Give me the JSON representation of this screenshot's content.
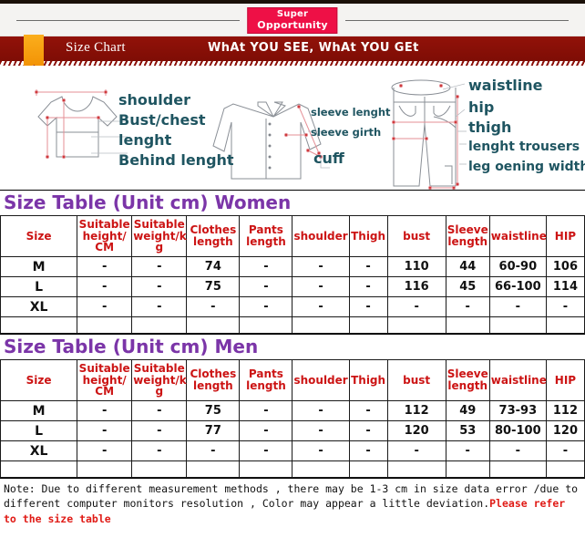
{
  "brand": {
    "line1": "Super",
    "line2": "Opportunity",
    "badge_color": "#ee1046"
  },
  "banner": {
    "title": "Size Chart",
    "slogan": "WhAt YOU SEE, WhAt YOU GEt",
    "bg_color": "#8c1008",
    "tab_color": "#f79f10"
  },
  "illustration": {
    "labels": {
      "shoulder": "shoulder",
      "bust_chest": "Bust/chest",
      "lenght": "lenght",
      "behind_lenght": "Behind lenght",
      "sleeve_lenght": "sleeve lenght",
      "sleeve_girth": "sleeve girth",
      "cuff": "cuff",
      "waistline": "waistline",
      "hip": "hip",
      "thigh": "thigh",
      "lenght_trousers": "lenght trousers",
      "leg_opening_width": "leg oening width"
    },
    "label_color": "#1f5561",
    "garment_line_color": "#8a8f96",
    "measure_line_color": "#e58f96"
  },
  "tables": [
    {
      "title": "Size Table (Unit cm) Women",
      "title_color": "#7b35a8",
      "headers": [
        "Size",
        "Suitable height/ CM",
        "Suitable weight/kg",
        "Clothes length",
        "Pants length",
        "shoulder",
        "Thigh",
        "bust",
        "Sleeve length",
        "waistline",
        "HIP"
      ],
      "rows": [
        [
          "M",
          "-",
          "-",
          "74",
          "-",
          "-",
          "-",
          "110",
          "44",
          "60-90",
          "106"
        ],
        [
          "L",
          "-",
          "-",
          "75",
          "-",
          "-",
          "-",
          "116",
          "45",
          "66-100",
          "114"
        ],
        [
          "XL",
          "-",
          "-",
          "-",
          "-",
          "-",
          "-",
          "-",
          "-",
          "-",
          "-"
        ]
      ]
    },
    {
      "title": "Size Table (Unit cm) Men",
      "title_color": "#7b35a8",
      "headers": [
        "Size",
        "Suitable height/ CM",
        "Suitable weight/kg",
        "Clothes length",
        "Pants length",
        "shoulder",
        "Thigh",
        "bust",
        "Sleeve length",
        "waistline",
        "HIP"
      ],
      "rows": [
        [
          "M",
          "-",
          "-",
          "75",
          "-",
          "-",
          "-",
          "112",
          "49",
          "73-93",
          "112"
        ],
        [
          "L",
          "-",
          "-",
          "77",
          "-",
          "-",
          "-",
          "120",
          "53",
          "80-100",
          "120"
        ],
        [
          "XL",
          "-",
          "-",
          "-",
          "-",
          "-",
          "-",
          "-",
          "-",
          "-",
          "-"
        ]
      ]
    }
  ],
  "header_parts": {
    "suitable": "Suitable",
    "height_cm_l1": "height/",
    "height_cm_l2": "CM",
    "weight_l1": "weight/k",
    "weight_l2": "g",
    "clothes_l1": "Clothes",
    "clothes_l2": "length",
    "pants_l1": "Pants",
    "pants_l2": "length",
    "sleeve_l1": "Sleeve",
    "sleeve_l2": "length",
    "size": "Size",
    "shoulder": "shoulder",
    "thigh": "Thigh",
    "bust": "bust",
    "waistline": "waistline",
    "hip": "HIP"
  },
  "note": {
    "text_black": "Note: Due to different measurement methods , there may be 1-3 cm in size data error /due to different computer monitors resolution , Color may appear a little deviation.",
    "text_red": "Please refer to the size table",
    "red_color": "#e01b16"
  }
}
